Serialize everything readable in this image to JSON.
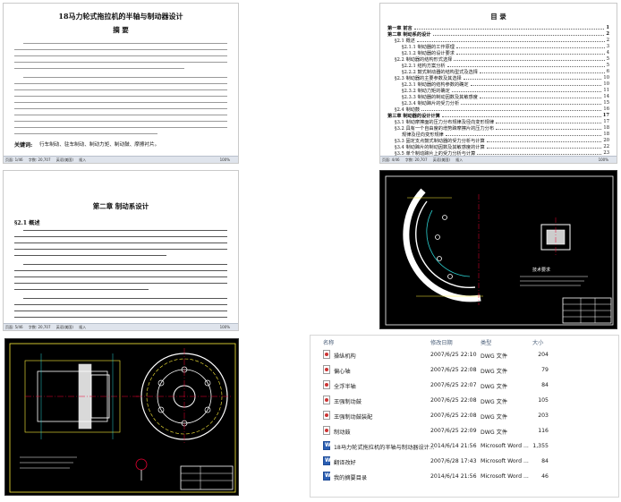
{
  "abstract_doc": {
    "title": "18马力轮式拖拉机的半轴与制动器设计",
    "heading": "摘  要",
    "keywords_label": "关键词:",
    "keywords": "行车制动、驻车制动、制动力矩、制动鼓、摩擦衬片。",
    "status": [
      "页面: 1/46",
      "字数: 20,707",
      "英语(美国)",
      "插入"
    ],
    "zoom": "100%"
  },
  "toc_doc": {
    "title": "目  录",
    "entries": [
      {
        "level": "ch",
        "text": "第一章  前言",
        "page": "1"
      },
      {
        "level": "ch",
        "text": "第二章  制动系的设计",
        "page": "2"
      },
      {
        "level": "1",
        "text": "§2.1 概述",
        "page": "2"
      },
      {
        "level": "2",
        "text": "§2.1.1 制动器的工作原理",
        "page": "3"
      },
      {
        "level": "2",
        "text": "§2.1.2 制动器的设计要求",
        "page": "4"
      },
      {
        "level": "1",
        "text": "§2.2 制动器的结构形式选择",
        "page": "5"
      },
      {
        "level": "2",
        "text": "§2.2.1 结构方案分析",
        "page": "5"
      },
      {
        "level": "2",
        "text": "§2.2.2 鼓式制动器的结构型式及选择",
        "page": "6"
      },
      {
        "level": "1",
        "text": "§2.3 制动器的主要参数及其选择",
        "page": "10"
      },
      {
        "level": "2",
        "text": "§2.3.1 制动器的结构参数的确定",
        "page": "10"
      },
      {
        "level": "2",
        "text": "§2.3.2 制动力矩的确定",
        "page": "11"
      },
      {
        "level": "2",
        "text": "§2.3.3 制动器的制动因数及其敏感度",
        "page": "14"
      },
      {
        "level": "2",
        "text": "§2.3.4 制动蹄片的受力分析",
        "page": "15"
      },
      {
        "level": "1",
        "text": "§2.4 制动鼓",
        "page": "16"
      },
      {
        "level": "ch",
        "text": "第三章  制动器的设计计算",
        "page": "17"
      },
      {
        "level": "1",
        "text": "§3.1 制动摩擦面的压力分布规律及径向变形规律",
        "page": "17"
      },
      {
        "level": "1",
        "text": "§3.2 具有一个自由度的增势蹄摩擦片的压力分布",
        "page": "18"
      },
      {
        "level": "2",
        "text": "规律及径向变形规律",
        "page": "18"
      },
      {
        "level": "1",
        "text": "§3.3 固定支点鼓式制动器的受力分析与计算",
        "page": "20"
      },
      {
        "level": "1",
        "text": "§3.4 制动蹄片的制动因数及其敏感度的计算",
        "page": "22"
      },
      {
        "level": "1",
        "text": "§3.5 单个制动蹄片上的受力分析与计算",
        "page": "23"
      }
    ],
    "status": [
      "页面: 4/46",
      "字数: 20,707",
      "英语(美国)",
      "插入"
    ],
    "zoom": "100%"
  },
  "chapter_doc": {
    "title": "第二章  制动系设计",
    "section": "§2.1 概述",
    "status": [
      "页面: 5/46",
      "字数: 20,707",
      "英语(美国)",
      "插入"
    ],
    "zoom": "100%"
  },
  "cad_shoe": {
    "notes_title": "技术要求"
  },
  "file_explorer": {
    "headers": {
      "name": "名称",
      "date": "修改日期",
      "type": "类型",
      "size": "大小"
    },
    "files": [
      {
        "name": "操纵机构",
        "date": "2007/6/25 22:10",
        "type": "DWG 文件",
        "size": "204",
        "icon": "dwg"
      },
      {
        "name": "偏心轴",
        "date": "2007/6/25 22:08",
        "type": "DWG 文件",
        "size": "79",
        "icon": "dwg"
      },
      {
        "name": "全浮半轴",
        "date": "2007/6/25 22:07",
        "type": "DWG 文件",
        "size": "84",
        "icon": "dwg"
      },
      {
        "name": "王强制动鼓",
        "date": "2007/6/25 22:08",
        "type": "DWG 文件",
        "size": "105",
        "icon": "dwg"
      },
      {
        "name": "王强制动鼓装配",
        "date": "2007/6/25 22:08",
        "type": "DWG 文件",
        "size": "203",
        "icon": "dwg"
      },
      {
        "name": "制动鼓",
        "date": "2007/6/25 22:09",
        "type": "DWG 文件",
        "size": "116",
        "icon": "dwg"
      },
      {
        "name": "18马力轮式拖拉机的半轴与制动器设计...",
        "date": "2014/6/14 21:56",
        "type": "Microsoft Word ...",
        "size": "1,355",
        "icon": "doc"
      },
      {
        "name": "翻译改好",
        "date": "2007/6/28 17:43",
        "type": "Microsoft Word ...",
        "size": "84",
        "icon": "doc"
      },
      {
        "name": "我的摘要目录",
        "date": "2014/6/14 21:56",
        "type": "Microsoft Word ...",
        "size": "46",
        "icon": "doc"
      }
    ]
  }
}
